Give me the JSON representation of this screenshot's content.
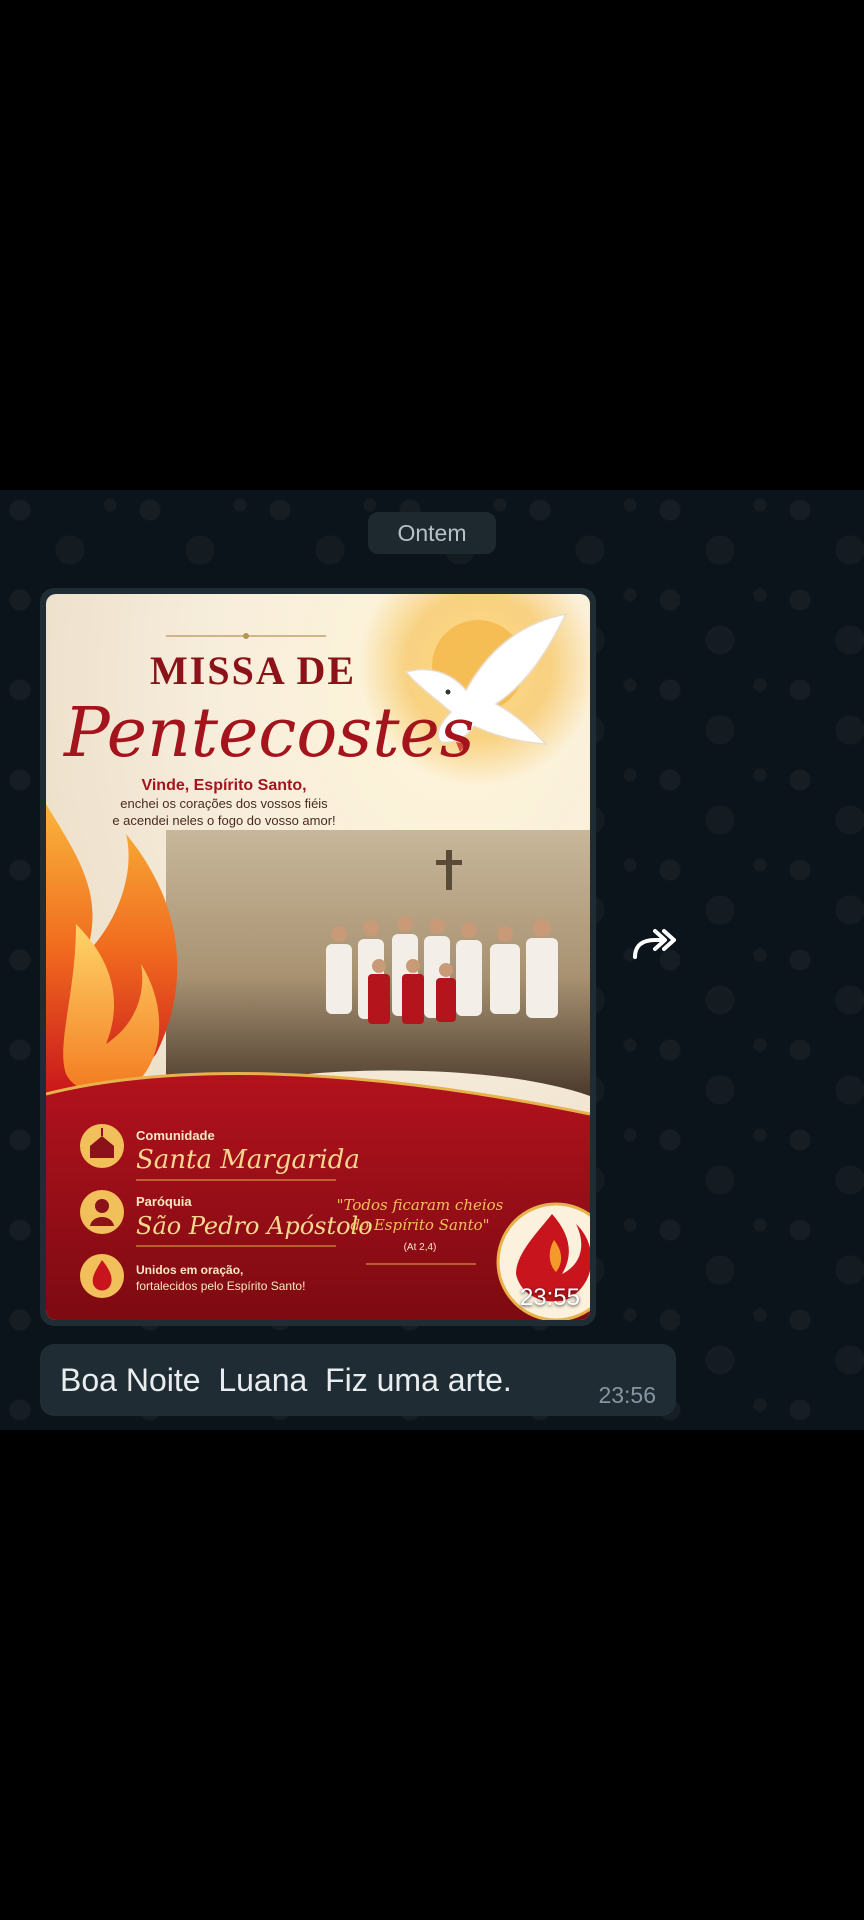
{
  "chat": {
    "date_label": "Ontem",
    "image_message": {
      "time": "23:55",
      "poster": {
        "title_top": "MISSA DE",
        "title_main": "Pentecostes",
        "subtitle_bold": "Vinde, Espírito Santo,",
        "subtitle_line2": "enchei os corações dos vossos fiéis",
        "subtitle_line3": "e acendei neles o fogo do vosso amor!",
        "community_label": "Comunidade",
        "community_name": "Santa Margarida",
        "parish_label": "Paróquia",
        "parish_name": "São Pedro Apóstolo",
        "united_line1": "Unidos em oração,",
        "united_line2": "fortalecidos pelo Espírito Santo!",
        "quote_line1": "\"Todos ficaram cheios",
        "quote_line2": "do Espírito Santo\"",
        "quote_ref": "(At 2,4)"
      }
    },
    "text_message": {
      "text": "Boa Noite  Luana  Fiz uma arte.",
      "time": "23:56"
    }
  }
}
